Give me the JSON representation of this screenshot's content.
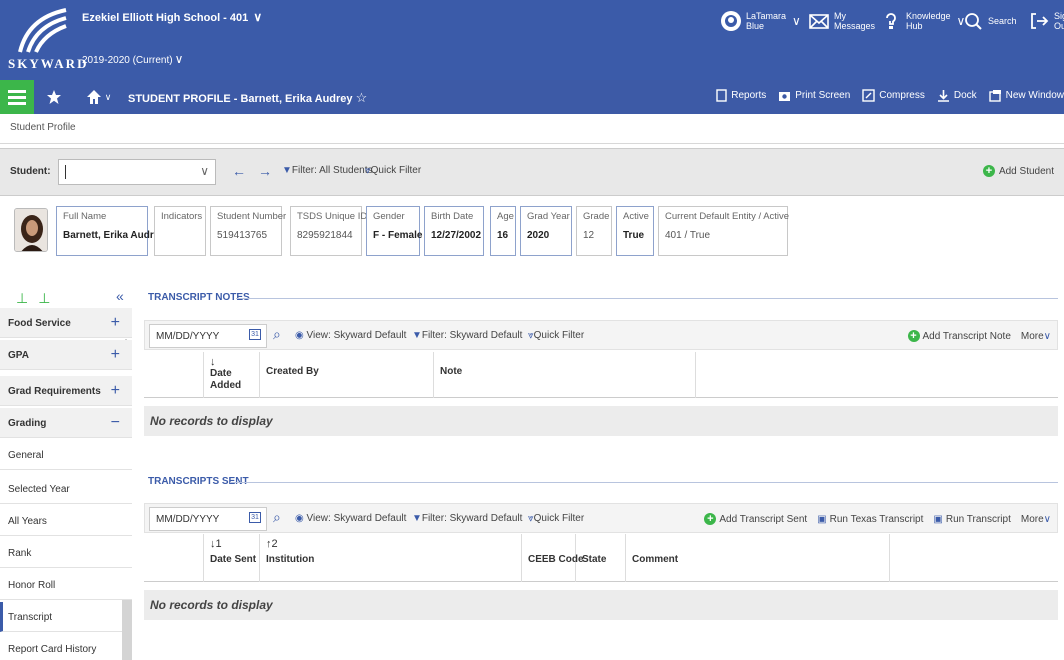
{
  "app": {
    "logo_text": "SKYWARD",
    "school": "Ezekiel Elliott High School - 401",
    "year": "2019-2020 (Current)",
    "user_line1": "LaTamara",
    "user_line2": "Blue",
    "messages_line1": "My",
    "messages_line2": "Messages",
    "knowledge_line1": "Knowledge",
    "knowledge_line2": "Hub",
    "search_label": "Search",
    "signout_line1": "Sign",
    "signout_line2": "Out",
    "chevron": "∨"
  },
  "nav": {
    "title": "STUDENT PROFILE - Barnett, Erika Audrey",
    "actions": [
      "Reports",
      "Print Screen",
      "Compress",
      "Dock",
      "New Window"
    ]
  },
  "breadcrumb": "Student Profile",
  "student_bar": {
    "label": "Student:",
    "filter": "Filter: All Students",
    "quick_filter": "Quick Filter",
    "add_student": "Add Student"
  },
  "profile": {
    "full_name_label": "Full Name",
    "full_name": "Barnett, Erika Audrey",
    "indicators_label": "Indicators",
    "student_number_label": "Student Number",
    "student_number": "519413765",
    "tsds_label": "TSDS Unique ID",
    "tsds": "8295921844",
    "gender_label": "Gender",
    "gender": "F - Female",
    "birth_label": "Birth Date",
    "birth": "12/27/2002",
    "age_label": "Age",
    "age": "16",
    "grad_year_label": "Grad Year",
    "grad_year": "2020",
    "grade_label": "Grade",
    "grade": "12",
    "active_label": "Active",
    "active": "True",
    "entity_label": "Current Default Entity / Active",
    "entity": "401 / True"
  },
  "sidebar": {
    "items": [
      {
        "label": "Food Service",
        "type": "group",
        "toggle": "+"
      },
      {
        "label": "GPA",
        "type": "group",
        "toggle": "+"
      },
      {
        "label": "Grad Requirements",
        "type": "group",
        "toggle": "+"
      },
      {
        "label": "Grading",
        "type": "group",
        "toggle": "−"
      },
      {
        "label": "General",
        "type": "item"
      },
      {
        "label": "Selected Year",
        "type": "item"
      },
      {
        "label": "All Years",
        "type": "item"
      },
      {
        "label": "Rank",
        "type": "item"
      },
      {
        "label": "Honor Roll",
        "type": "item"
      },
      {
        "label": "Transcript",
        "type": "active"
      },
      {
        "label": "Report Card History",
        "type": "item"
      }
    ]
  },
  "notes": {
    "title": "TRANSCRIPT NOTES",
    "date_placeholder": "MM/DD/YYYY",
    "view": "View: Skyward Default",
    "filter": "Filter: Skyward Default",
    "quick_filter": "Quick Filter",
    "add": "Add Transcript Note",
    "more": "More",
    "columns": [
      {
        "label": "Date Added",
        "sort": "↓"
      },
      {
        "label": "Created By",
        "sort": ""
      },
      {
        "label": "Note",
        "sort": ""
      }
    ],
    "empty": "No records to display"
  },
  "sent": {
    "title": "TRANSCRIPTS SENT",
    "date_placeholder": "MM/DD/YYYY",
    "view": "View: Skyward Default",
    "filter": "Filter: Skyward Default",
    "quick_filter": "Quick Filter",
    "add": "Add Transcript Sent",
    "run_texas": "Run Texas Transcript",
    "run": "Run Transcript",
    "more": "More",
    "columns": [
      {
        "label": "Date Sent",
        "sort": "↓1"
      },
      {
        "label": "Institution",
        "sort": "↑2"
      },
      {
        "label": "CEEB Code",
        "sort": ""
      },
      {
        "label": "State",
        "sort": ""
      },
      {
        "label": "Comment",
        "sort": ""
      }
    ],
    "empty": "No records to display"
  },
  "colors": {
    "header_blue": "#3b5ba9",
    "green": "#3cb64a"
  }
}
